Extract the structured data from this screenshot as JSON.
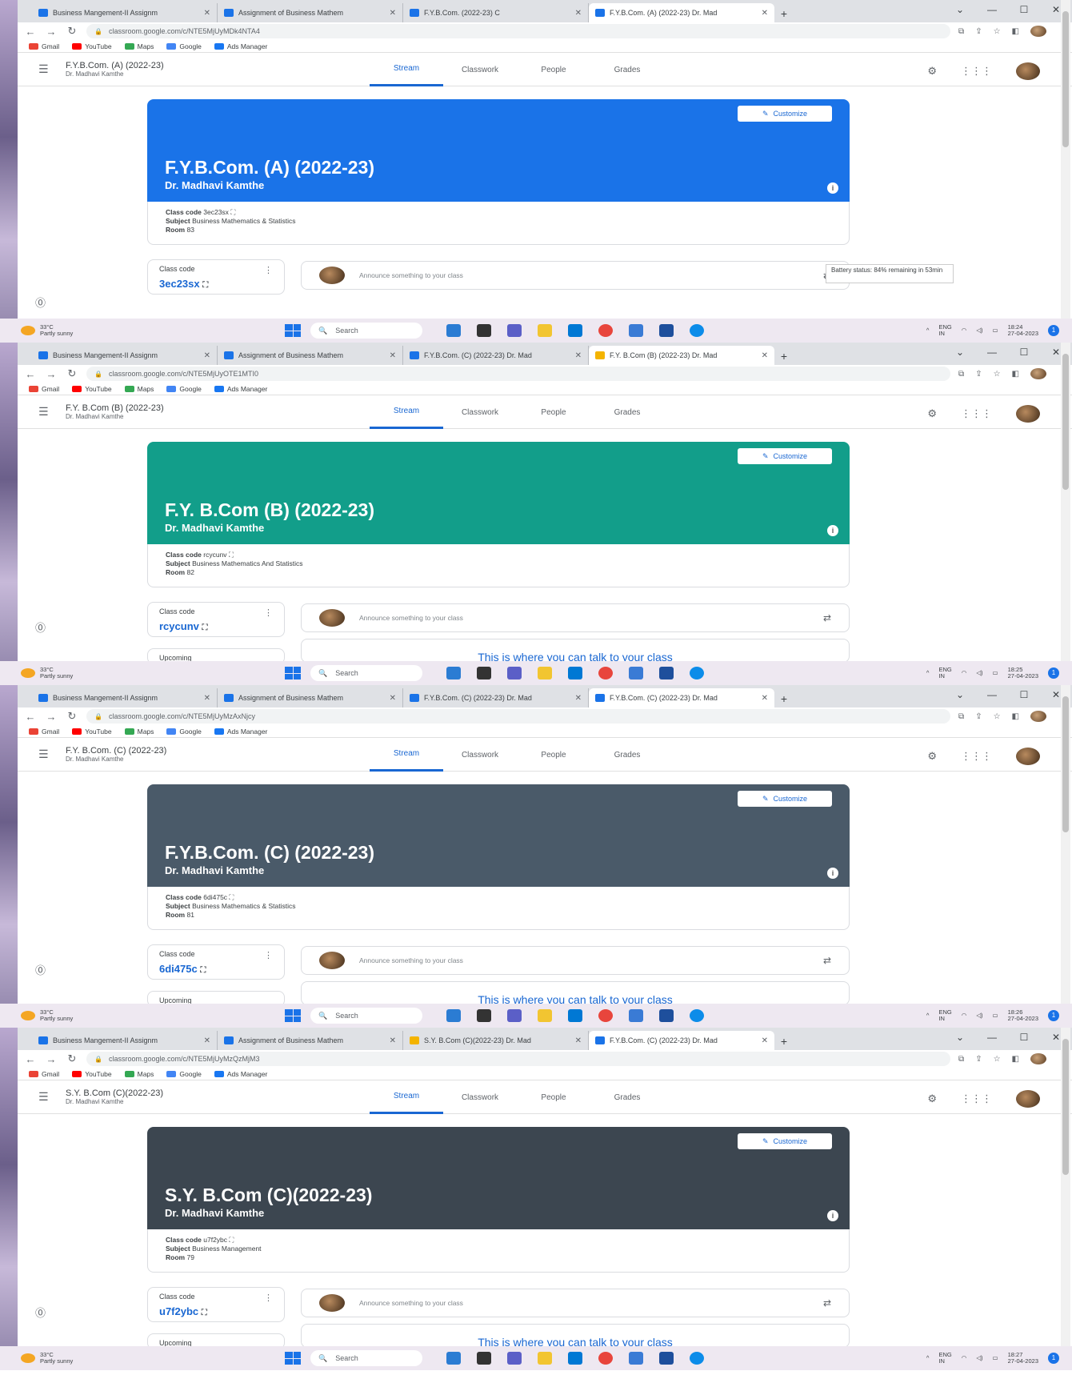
{
  "browser": {
    "common_tabs": [
      "Business Mangement-II Assignm",
      "Assignment of Business Mathem"
    ],
    "bookmarks": [
      "Gmail",
      "YouTube",
      "Maps",
      "Google",
      "Ads Manager"
    ]
  },
  "classroom": {
    "tabs": [
      "Stream",
      "Classwork",
      "People",
      "Grades"
    ],
    "customize": "Customize",
    "class_code_label": "Class code",
    "announce_placeholder": "Announce something to your class",
    "talk_text": "This is where you can talk to your class",
    "upcoming": "Upcoming"
  },
  "taskbar": {
    "temp": "33°C",
    "weather": "Partly sunny",
    "search": "Search",
    "lang": "ENG",
    "region": "IN",
    "date": "27-04-2023"
  },
  "screens": [
    {
      "tab3": "F.Y.B.Com. (2022-23) C",
      "tab4": "F.Y.B.Com. (A) (2022-23) Dr. Mad",
      "url": "classroom.google.com/c/NTE5MjUyMDk4NTA4",
      "header_title": "F.Y.B.Com. (A) (2022-23)",
      "header_sub": "Dr. Madhavi Kamthe",
      "banner_title": "F.Y.B.Com. (A) (2022-23)",
      "banner_sub": "Dr. Madhavi Kamthe",
      "code": "3ec23sx",
      "subject": "Business Mathematics & Statistics",
      "room": "83",
      "time": "18:24",
      "battery_note": "Battery status: 84% remaining in 53min",
      "banner_color": "#1a73e8"
    },
    {
      "tab3": "F.Y.B.Com. (C) (2022-23) Dr. Mad",
      "tab4": "F.Y. B.Com (B) (2022-23) Dr. Mad",
      "url": "classroom.google.com/c/NTE5MjUyOTE1MTI0",
      "header_title": "F.Y. B.Com (B) (2022-23)",
      "header_sub": "Dr. Madhavi Kamthe",
      "banner_title": "F.Y. B.Com (B) (2022-23)",
      "banner_sub": "Dr. Madhavi Kamthe",
      "code": "rcycunv",
      "subject": "Business Mathematics And Statistics",
      "room": "82",
      "time": "18:25",
      "battery_note": "",
      "banner_color": "#129e8a"
    },
    {
      "tab3": "F.Y.B.Com. (C) (2022-23) Dr. Mad",
      "tab4": "F.Y.B.Com. (C) (2022-23) Dr. Mad",
      "url": "classroom.google.com/c/NTE5MjUyMzAxNjcy",
      "header_title": "F.Y. B.Com. (C) (2022-23)",
      "header_sub": "Dr. Madhavi Kamthe",
      "banner_title": "F.Y.B.Com. (C) (2022-23)",
      "banner_sub": "Dr. Madhavi Kamthe",
      "code": "6di475c",
      "subject": "Business Mathematics & Statistics",
      "room": "81",
      "time": "18:26",
      "battery_note": "",
      "banner_color": "#4a5a69"
    },
    {
      "tab3": "S.Y. B.Com (C)(2022-23) Dr. Mad",
      "tab4": "F.Y.B.Com. (C) (2022-23) Dr. Mad",
      "url": "classroom.google.com/c/NTE5MjUyMzQzMjM3",
      "header_title": "S.Y. B.Com (C)(2022-23)",
      "header_sub": "Dr. Madhavi Kamthe",
      "banner_title": "S.Y. B.Com (C)(2022-23)",
      "banner_sub": "Dr. Madhavi Kamthe",
      "code": "u7f2ybc",
      "subject": "Business Management",
      "room": "79",
      "time": "18:27",
      "battery_note": "",
      "banner_color": "#3c4650"
    }
  ]
}
